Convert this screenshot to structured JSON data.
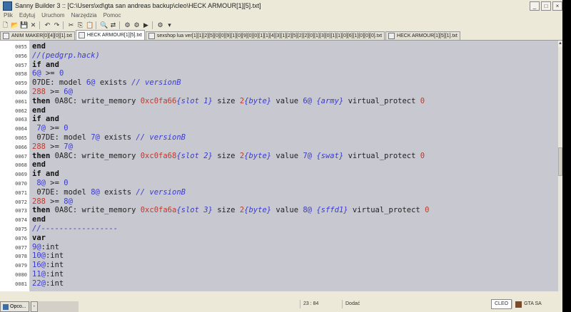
{
  "window": {
    "title": "Sanny Builder 3 :: [C:\\Users\\xd\\gta san andreas backup\\cleo\\HECK ARMOUR[1][5].txt]",
    "controls": [
      "_",
      "□",
      "×"
    ]
  },
  "menu": [
    "Plik",
    "Edytuj",
    "Uruchom",
    "Narzędzia",
    "Pomoc"
  ],
  "toolbar": {
    "icons": [
      "new-icon",
      "open-icon",
      "save-icon",
      "close-icon",
      "undo-icon",
      "redo-icon",
      "cut-icon",
      "copy-icon",
      "paste-icon",
      "find-icon",
      "replace-icon",
      "compile-icon",
      "decompile-icon",
      "run-icon",
      "options-icon",
      "dropdown-icon"
    ],
    "glyphs": [
      "🗋",
      "📂",
      "💾",
      "✕",
      "↶",
      "↷",
      "✂",
      "⎘",
      "📋",
      "🔍",
      "⇄",
      "⚙",
      "⚙",
      "▶",
      "⚙",
      "▾"
    ]
  },
  "tabs": [
    {
      "label": "ANIM MAKER[0][4][0][1].txt",
      "active": false
    },
    {
      "label": "HECK ARMOUR[1][5].txt",
      "active": true
    },
    {
      "label": "sexshop lua ver[1][1][2][5][0][0][9][1][0][9][0][0][1][1][4][3][1][2][5][2][2][0][1][3][0][1][1][0][6][1][0][0][0].txt",
      "active": false
    },
    {
      "label": "HECK ARMOUR[1][5][1].txt",
      "active": false
    }
  ],
  "editor": {
    "lines": [
      {
        "num": "0055",
        "tokens": [
          {
            "t": "end",
            "c": "kw"
          }
        ]
      },
      {
        "num": "0056",
        "tokens": [
          {
            "t": "//(pedgrp.hack)",
            "c": "cmt"
          }
        ]
      },
      {
        "num": "0057",
        "tokens": [
          {
            "t": "if and",
            "c": "kw"
          }
        ]
      },
      {
        "num": "0058",
        "tokens": [
          {
            "t": "6@",
            "c": "num"
          },
          {
            "t": " >= ",
            "c": ""
          },
          {
            "t": "0",
            "c": "num"
          }
        ]
      },
      {
        "num": "0059",
        "tokens": [
          {
            "t": "07DE: model ",
            "c": ""
          },
          {
            "t": "6@",
            "c": "num"
          },
          {
            "t": " exists ",
            "c": ""
          },
          {
            "t": "// versionB",
            "c": "cmt"
          }
        ]
      },
      {
        "num": "0060",
        "tokens": [
          {
            "t": "288",
            "c": "ex"
          },
          {
            "t": " >= ",
            "c": ""
          },
          {
            "t": "6@",
            "c": "num"
          }
        ]
      },
      {
        "num": "0061",
        "tokens": [
          {
            "t": "then",
            "c": "kw"
          },
          {
            "t": " 0A8C: write_memory ",
            "c": ""
          },
          {
            "t": "0xc0fa66",
            "c": "ex"
          },
          {
            "t": "{slot 1}",
            "c": "cmt"
          },
          {
            "t": " size ",
            "c": ""
          },
          {
            "t": "2",
            "c": "ex"
          },
          {
            "t": "{byte}",
            "c": "cmt"
          },
          {
            "t": " value ",
            "c": ""
          },
          {
            "t": "6@",
            "c": "num"
          },
          {
            "t": " ",
            "c": ""
          },
          {
            "t": "{army}",
            "c": "cmt"
          },
          {
            "t": " virtual_protect ",
            "c": ""
          },
          {
            "t": "0",
            "c": "ex"
          }
        ]
      },
      {
        "num": "0062",
        "tokens": [
          {
            "t": "end",
            "c": "kw"
          }
        ]
      },
      {
        "num": "0063",
        "tokens": [
          {
            "t": "if and",
            "c": "kw"
          }
        ]
      },
      {
        "num": "0064",
        "tokens": [
          {
            "t": " 7@",
            "c": "num"
          },
          {
            "t": " >= ",
            "c": ""
          },
          {
            "t": "0",
            "c": "num"
          }
        ]
      },
      {
        "num": "0065",
        "tokens": [
          {
            "t": " 07DE: model ",
            "c": ""
          },
          {
            "t": "7@",
            "c": "num"
          },
          {
            "t": " exists ",
            "c": ""
          },
          {
            "t": "// versionB",
            "c": "cmt"
          }
        ]
      },
      {
        "num": "0066",
        "tokens": [
          {
            "t": "288",
            "c": "ex"
          },
          {
            "t": " >= ",
            "c": ""
          },
          {
            "t": "7@",
            "c": "num"
          }
        ]
      },
      {
        "num": "0067",
        "tokens": [
          {
            "t": "then",
            "c": "kw"
          },
          {
            "t": " 0A8C: write_memory ",
            "c": ""
          },
          {
            "t": "0xc0fa68",
            "c": "ex"
          },
          {
            "t": "{slot 2}",
            "c": "cmt"
          },
          {
            "t": " size ",
            "c": ""
          },
          {
            "t": "2",
            "c": "ex"
          },
          {
            "t": "{byte}",
            "c": "cmt"
          },
          {
            "t": " value ",
            "c": ""
          },
          {
            "t": "7@",
            "c": "num"
          },
          {
            "t": " ",
            "c": ""
          },
          {
            "t": "{swat}",
            "c": "cmt"
          },
          {
            "t": " virtual_protect ",
            "c": ""
          },
          {
            "t": "0",
            "c": "ex"
          }
        ]
      },
      {
        "num": "0068",
        "tokens": [
          {
            "t": "end",
            "c": "kw"
          }
        ]
      },
      {
        "num": "0069",
        "tokens": [
          {
            "t": "if and",
            "c": "kw"
          }
        ]
      },
      {
        "num": "0070",
        "tokens": [
          {
            "t": " 8@",
            "c": "num"
          },
          {
            "t": " >= ",
            "c": ""
          },
          {
            "t": "0",
            "c": "num"
          }
        ]
      },
      {
        "num": "0071",
        "tokens": [
          {
            "t": " 07DE: model ",
            "c": ""
          },
          {
            "t": "8@",
            "c": "num"
          },
          {
            "t": " exists ",
            "c": ""
          },
          {
            "t": "// versionB",
            "c": "cmt"
          }
        ]
      },
      {
        "num": "0072",
        "tokens": [
          {
            "t": "288",
            "c": "ex"
          },
          {
            "t": " >= ",
            "c": ""
          },
          {
            "t": "8@",
            "c": "num"
          }
        ]
      },
      {
        "num": "0073",
        "tokens": [
          {
            "t": "then",
            "c": "kw"
          },
          {
            "t": " 0A8C: write_memory ",
            "c": ""
          },
          {
            "t": "0xc0fa6a",
            "c": "ex"
          },
          {
            "t": "{slot 3}",
            "c": "cmt"
          },
          {
            "t": " size ",
            "c": ""
          },
          {
            "t": "2",
            "c": "ex"
          },
          {
            "t": "{byte}",
            "c": "cmt"
          },
          {
            "t": " value ",
            "c": ""
          },
          {
            "t": "8@",
            "c": "num"
          },
          {
            "t": " ",
            "c": ""
          },
          {
            "t": "{sffd1}",
            "c": "cmt"
          },
          {
            "t": " virtual_protect ",
            "c": ""
          },
          {
            "t": "0",
            "c": "ex"
          }
        ]
      },
      {
        "num": "0074",
        "tokens": [
          {
            "t": "end",
            "c": "kw"
          }
        ]
      },
      {
        "num": "0075",
        "tokens": [
          {
            "t": "//-----------------",
            "c": "cmt"
          }
        ]
      },
      {
        "num": "0076",
        "tokens": [
          {
            "t": "var",
            "c": "kw"
          }
        ]
      },
      {
        "num": "0077",
        "tokens": [
          {
            "t": "9@",
            "c": "num"
          },
          {
            "t": ":int",
            "c": ""
          }
        ]
      },
      {
        "num": "0078",
        "tokens": [
          {
            "t": "10@",
            "c": "num"
          },
          {
            "t": ":int",
            "c": ""
          }
        ]
      },
      {
        "num": "0079",
        "tokens": [
          {
            "t": "16@",
            "c": "num"
          },
          {
            "t": ":int",
            "c": ""
          }
        ]
      },
      {
        "num": "0080",
        "tokens": [
          {
            "t": "11@",
            "c": "num"
          },
          {
            "t": ":int",
            "c": ""
          }
        ]
      },
      {
        "num": "0081",
        "tokens": [
          {
            "t": "22@",
            "c": "num"
          },
          {
            "t": ":int",
            "c": ""
          }
        ]
      }
    ]
  },
  "status": {
    "position": "23 : 84",
    "mode": "Dodać",
    "cleo": "CLEO",
    "game": "GTA SA"
  },
  "taskbar": {
    "item1": "Opco...",
    "item2": "-"
  }
}
